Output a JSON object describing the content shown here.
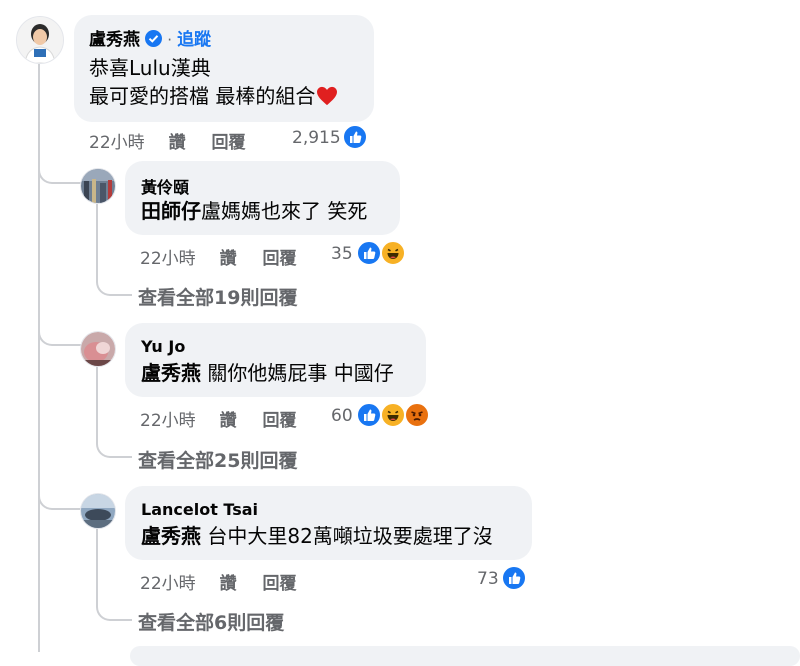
{
  "main_comment": {
    "author": "盧秀燕",
    "follow_label": "追蹤",
    "separator": "·",
    "line1": "恭喜Lulu漢典",
    "line2": "最可愛的搭檔 最棒的組合",
    "heart_icon": "red-heart-icon",
    "time": "22小時",
    "like_label": "讚",
    "reply_label": "回覆",
    "reaction_count": "2,915"
  },
  "replies": [
    {
      "author": "黃伶頤",
      "mention": "田師仔",
      "text": "盧媽媽也來了 笑死",
      "time": "22小時",
      "like_label": "讚",
      "reply_label": "回覆",
      "reaction_count": "35",
      "view_all": "查看全部19則回覆"
    },
    {
      "author": "Yu Jo",
      "mention": "盧秀燕",
      "text": " 關你他媽屁事 中國仔",
      "time": "22小時",
      "like_label": "讚",
      "reply_label": "回覆",
      "reaction_count": "60",
      "view_all": "查看全部25則回覆"
    },
    {
      "author": "Lancelot Tsai",
      "mention": "盧秀燕",
      "text": " 台中大里82萬噸垃圾要處理了沒",
      "time": "22小時",
      "like_label": "讚",
      "reply_label": "回覆",
      "reaction_count": "73",
      "view_all": "查看全部6則回覆"
    }
  ],
  "colors": {
    "bubble": "#f0f2f5",
    "link": "#1877f2",
    "secondary": "#65676b",
    "thread_line": "#ced0d4"
  }
}
